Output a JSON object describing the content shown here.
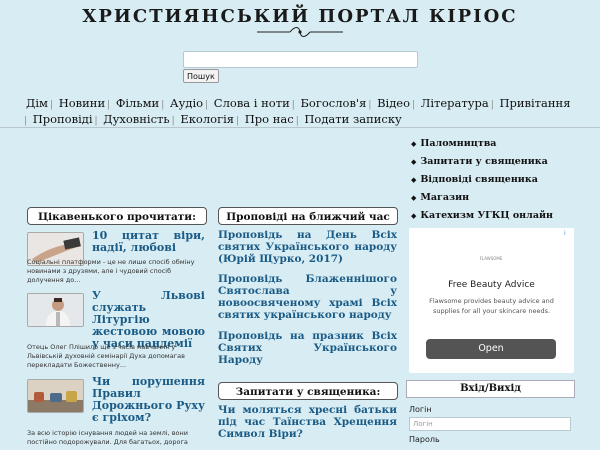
{
  "header": {
    "site_title": "ХРИСТИЯНСЬКИЙ ПОРТАЛ КІРІОС",
    "search_placeholder": "",
    "search_button": "Пошук"
  },
  "nav": {
    "row1": [
      "Дім",
      "Новини",
      "Фільми",
      "Аудіо",
      "Слова і ноти",
      "Богослов'я",
      "Відео",
      "Література",
      "Привітання"
    ],
    "row2": [
      "Проповіді",
      "Духовність",
      "Екологія",
      "Про нас",
      "Подати записку"
    ]
  },
  "quick_links": [
    "Паломництва",
    "Запитати у священика",
    "Відповіді священика",
    "Магазин",
    "Катехизм УГКЦ онлайн"
  ],
  "left_column": {
    "header": "Цікавенького прочитати:",
    "articles": [
      {
        "title": "10 цитат віри, надії, любові",
        "desc": "Соціальні платформи - це не лише спосіб обміну новинами з друзями, але і чудовий спосіб долучення до..."
      },
      {
        "title": "У Львові служать Літургію жестовою мовою у часи пандемії",
        "desc": "Отець Олег Плішило ще з часів навчання у Львівській духовній семінарії Духа допомагав перекладати Божественну..."
      },
      {
        "title": "Чи порушення Правил Дорожнього Руху є гріхом?",
        "desc": "За всю історію існування людей на землі, вони постійно подорожували. Для багатьох, дорога"
      }
    ]
  },
  "middle_column": {
    "header": "Проповіді на ближчий час",
    "sermons": [
      "Проповідь на День Всіх святих Українського народу (Юрій Щурко, 2017)",
      "Проповідь Блаженнішого Святослава у новоосвяченому храмі Всіх святих українського народу",
      "Проповідь на празник Всіх Святих Українського Народу"
    ],
    "header2": "Запитати у священика:",
    "questions": [
      "Чи моляться хресні батьки під час Таїнства Хрещення Символ Віри?"
    ]
  },
  "ad": {
    "brand": "FLAWSOME",
    "title": "Free Beauty Advice",
    "text": "Flawsome provides beauty advice and supplies for all your skincare needs.",
    "button": "Open",
    "badge": "i"
  },
  "login": {
    "header": "Вхід/Вихід",
    "login_label": "Логін",
    "login_placeholder": "Логін",
    "password_label": "Пароль"
  },
  "colors": {
    "background": "#d8ecf3",
    "link": "#1a5b86",
    "ad_button": "#545454"
  }
}
